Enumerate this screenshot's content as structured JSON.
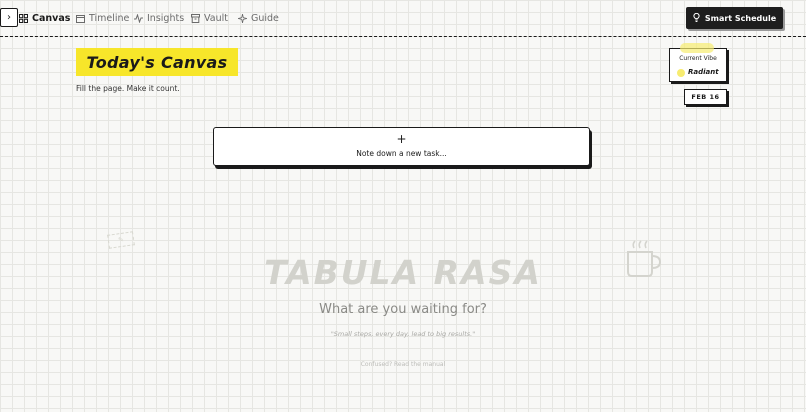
{
  "nav": {
    "toggle_icon": "chevron-right-icon",
    "items": [
      {
        "label": "Canvas",
        "icon": "grid-icon",
        "active": true
      },
      {
        "label": "Timeline",
        "icon": "calendar-icon",
        "active": false
      },
      {
        "label": "Insights",
        "icon": "activity-icon",
        "active": false
      },
      {
        "label": "Vault",
        "icon": "archive-icon",
        "active": false
      },
      {
        "label": "Guide",
        "icon": "sparkle-icon",
        "active": false
      }
    ],
    "smart_schedule_label": "Smart Schedule",
    "smart_schedule_icon": "lightbulb-icon"
  },
  "header": {
    "title": "Today's Canvas",
    "subtitle": "Fill the page. Make it count."
  },
  "vibe": {
    "label": "Current Vibe",
    "value": "Radiant",
    "color": "#f7ec70"
  },
  "date_badge": "FEB 16",
  "new_task": {
    "icon": "plus-icon",
    "label": "Note down a new task..."
  },
  "empty_state": {
    "headline": "TABULA RASA",
    "prompt": "What are you waiting for?",
    "quote": "\"Small steps, every day, lead to big results.\"",
    "help_link": "Confused? Read the manual"
  },
  "colors": {
    "accent_yellow": "#f7e62a",
    "ink": "#1a1a1a",
    "paper": "#f8f8f6"
  }
}
